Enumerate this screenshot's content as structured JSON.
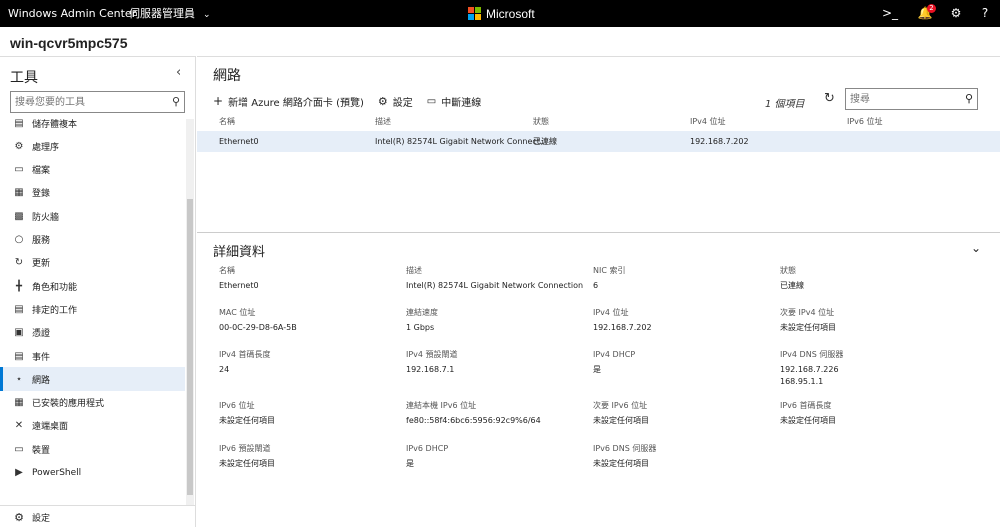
{
  "topbar": {
    "app_title": "Windows Admin Center",
    "server_manager": "伺服器管理員",
    "brand": "Microsoft",
    "notification_count": "2",
    "terminal_glyph": ">_",
    "help_glyph": "?"
  },
  "server_name": "win-qcvr5mpc575",
  "sidebar": {
    "heading": "工具",
    "search_placeholder": "搜尋您要的工具",
    "items": [
      {
        "label": "儲存體複本",
        "icon": "storage-replica-icon"
      },
      {
        "label": "處理序",
        "icon": "processes-icon"
      },
      {
        "label": "檔案",
        "icon": "files-icon"
      },
      {
        "label": "登錄",
        "icon": "registry-icon"
      },
      {
        "label": "防火牆",
        "icon": "firewall-icon"
      },
      {
        "label": "服務",
        "icon": "services-icon"
      },
      {
        "label": "更新",
        "icon": "updates-icon"
      },
      {
        "label": "角色和功能",
        "icon": "roles-features-icon"
      },
      {
        "label": "排定的工作",
        "icon": "scheduled-tasks-icon"
      },
      {
        "label": "憑證",
        "icon": "certificates-icon"
      },
      {
        "label": "事件",
        "icon": "events-icon"
      },
      {
        "label": "網路",
        "icon": "network-icon"
      },
      {
        "label": "已安裝的應用程式",
        "icon": "installed-apps-icon"
      },
      {
        "label": "遠端桌面",
        "icon": "remote-desktop-icon"
      },
      {
        "label": "裝置",
        "icon": "devices-icon"
      },
      {
        "label": "PowerShell",
        "icon": "powershell-icon"
      }
    ],
    "active_index": 11,
    "settings_label": "設定"
  },
  "main": {
    "title": "網路",
    "toolbar": {
      "add_azure": "新增 Azure 網路介面卡 (預覽)",
      "settings": "設定",
      "disconnect": "中斷連線"
    },
    "item_count": "1 個項目",
    "search_placeholder": "搜尋",
    "columns": [
      "名稱",
      "描述",
      "狀態",
      "IPv4 位址",
      "IPv6 位址"
    ],
    "rows": [
      {
        "name": "Ethernet0",
        "desc": "Intel(R) 82574L Gigabit Network Connect...",
        "status": "已連線",
        "ipv4": "192.168.7.202",
        "ipv6": ""
      }
    ]
  },
  "details": {
    "title": "詳細資料",
    "fields": [
      {
        "label": "名稱",
        "value": "Ethernet0"
      },
      {
        "label": "描述",
        "value": "Intel(R) 82574L Gigabit Network Connection"
      },
      {
        "label": "NIC 索引",
        "value": "6"
      },
      {
        "label": "狀態",
        "value": "已連線"
      },
      {
        "label": "MAC 位址",
        "value": "00-0C-29-D8-6A-5B"
      },
      {
        "label": "連結速度",
        "value": "1 Gbps"
      },
      {
        "label": "IPv4 位址",
        "value": "192.168.7.202"
      },
      {
        "label": "次要 IPv4 位址",
        "value": "未設定任何項目"
      },
      {
        "label": "IPv4 首碼長度",
        "value": "24"
      },
      {
        "label": "IPv4 預設閘道",
        "value": "192.168.7.1"
      },
      {
        "label": "IPv4 DHCP",
        "value": "是"
      },
      {
        "label": "IPv4 DNS 伺服器",
        "value": "192.168.7.226\n168.95.1.1"
      },
      {
        "label": "IPv6 位址",
        "value": "未設定任何項目"
      },
      {
        "label": "連結本機 IPv6 位址",
        "value": "fe80::58f4:6bc6:5956:92c9%6/64"
      },
      {
        "label": "次要 IPv6 位址",
        "value": "未設定任何項目"
      },
      {
        "label": "IPv6 首碼長度",
        "value": "未設定任何項目"
      },
      {
        "label": "IPv6 預設閘道",
        "value": "未設定任何項目"
      },
      {
        "label": "IPv6 DHCP",
        "value": "是"
      },
      {
        "label": "IPv6 DNS 伺服器",
        "value": "未設定任何項目"
      }
    ]
  },
  "colors": {
    "topbar": "#000000",
    "accent": "#0078d4",
    "selected_row": "#e6eef8",
    "badge": "#e81123"
  }
}
